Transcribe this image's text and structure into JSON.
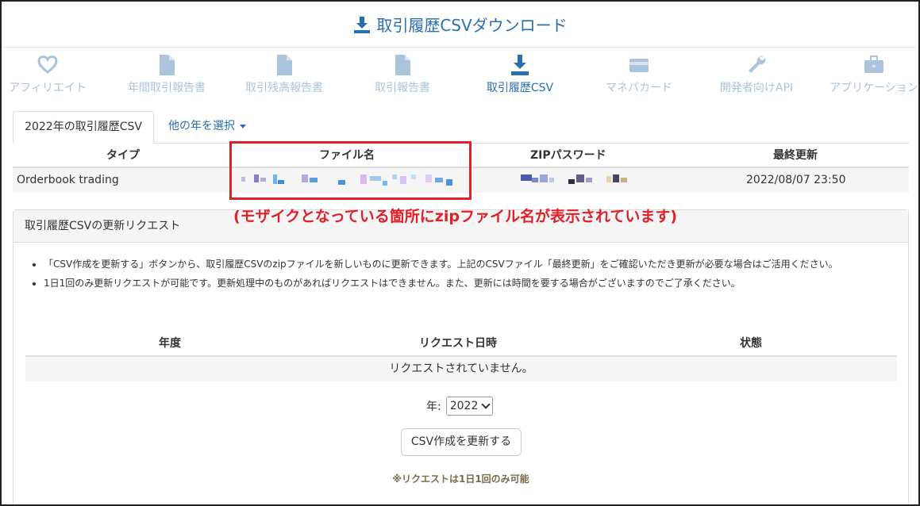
{
  "header": {
    "title": "取引履歴CSVダウンロード",
    "icon": "download-icon",
    "color": "#2a6fb0"
  },
  "nav": {
    "items": [
      {
        "label": "アフィリエイト",
        "icon": "heart-icon",
        "active": false
      },
      {
        "label": "年間取引報告書",
        "icon": "document-icon",
        "active": false
      },
      {
        "label": "取引残高報告書",
        "icon": "document-icon",
        "active": false
      },
      {
        "label": "取引報告書",
        "icon": "document-icon",
        "active": false
      },
      {
        "label": "取引履歴CSV",
        "icon": "download-icon",
        "active": true
      },
      {
        "label": "マネパカード",
        "icon": "credit-card-icon",
        "active": false
      },
      {
        "label": "開発者向けAPI",
        "icon": "wrench-icon",
        "active": false
      },
      {
        "label": "アプリケーション",
        "icon": "briefcase-icon",
        "active": false
      }
    ],
    "inactive_color": "#aac4dd"
  },
  "tabs": {
    "active": "2022年の取引履歴CSV",
    "other": "他の年を選択"
  },
  "files_table": {
    "headers": [
      "タイプ",
      "ファイル名",
      "ZIPパスワード",
      "最終更新"
    ],
    "rows": [
      {
        "type": "Orderbook trading",
        "last_updated": "2022/08/07 23:50"
      }
    ]
  },
  "annotation": {
    "note": "(モザイクとなっている箇所にzipファイル名が表示されています)",
    "color": "#e0202a"
  },
  "request_panel": {
    "title": "取引履歴CSVの更新リクエスト",
    "notes": [
      "「CSV作成を更新する」ボタンから、取引履歴CSVのzipファイルを新しいものに更新できます。上記のCSVファイル「最終更新」をご確認いただき更新が必要な場合はご活用ください。",
      "1日1回のみ更新リクエストが可能です。更新処理中のものがあればリクエストはできません。また、更新には時間を要する場合がございますのでご了承ください。"
    ],
    "table_headers": [
      "年度",
      "リクエスト日時",
      "状態"
    ],
    "empty_message": "リクエストされていません。",
    "year_label": "年:",
    "year_value": "2022",
    "button_label": "CSV作成を更新する",
    "limit_note": "※リクエストは1日1回のみ可能"
  }
}
